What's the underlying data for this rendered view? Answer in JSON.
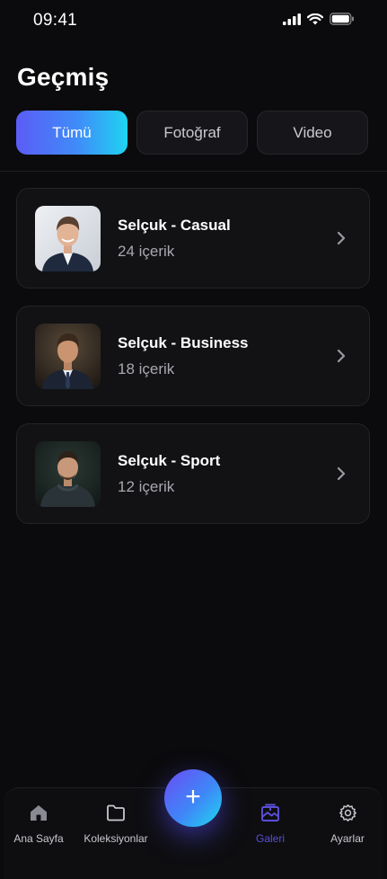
{
  "status_bar": {
    "time": "09:41",
    "icons": [
      "signal-icon",
      "wifi-icon",
      "battery-icon"
    ]
  },
  "header": {
    "title": "Geçmiş"
  },
  "tabs": [
    {
      "label": "Tümü",
      "active": true
    },
    {
      "label": "Fotoğraf",
      "active": false
    },
    {
      "label": "Video",
      "active": false
    }
  ],
  "albums": [
    {
      "name": "Selçuk - Casual",
      "count": "24 içerik",
      "thumbnail": "casual-portrait"
    },
    {
      "name": "Selçuk - Business",
      "count": "18 içerik",
      "thumbnail": "business-portrait"
    },
    {
      "name": "Selçuk - Sport",
      "count": "12 içerik",
      "thumbnail": "sport-portrait"
    }
  ],
  "bottom_nav": {
    "items": [
      {
        "label": "Ana Sayfa",
        "icon": "home-icon",
        "active": false
      },
      {
        "label": "Koleksiyonlar",
        "icon": "folder-icon",
        "active": false
      },
      {
        "label": "Galeri",
        "icon": "gallery-icon",
        "active": true
      },
      {
        "label": "Ayarlar",
        "icon": "gear-icon",
        "active": false
      }
    ],
    "fab": {
      "label": "+",
      "icon": "plus-icon"
    }
  },
  "colors": {
    "background": "#0b0b0d",
    "card": "#121215",
    "accent_gradient_start": "#5b5cf6",
    "accent_gradient_end": "#1fd4f2",
    "active_nav": "#5a4fd8",
    "muted_text": "#a8a8b0"
  }
}
